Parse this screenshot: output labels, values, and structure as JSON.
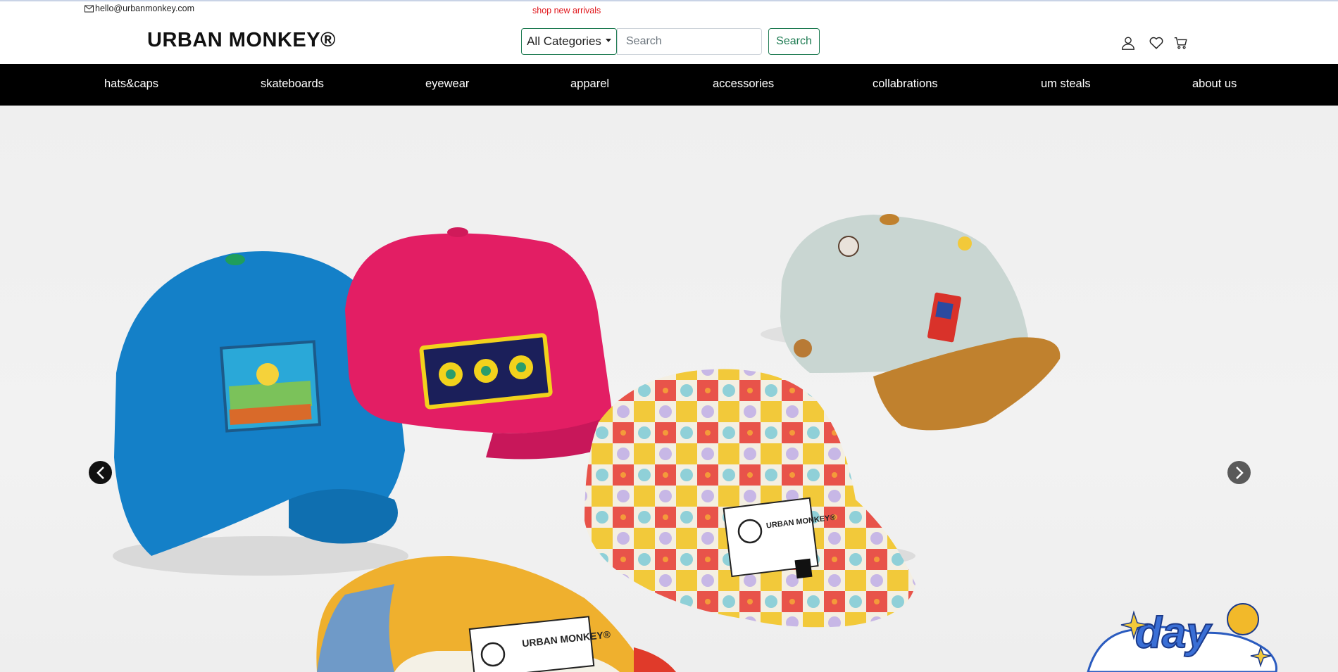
{
  "util": {
    "email": "hello@urbanmonkey.com",
    "promo": "shop new arrivals"
  },
  "header": {
    "logo": "URBAN MONKEY®",
    "category_label": "All Categories",
    "search_placeholder": "Search",
    "search_button": "Search",
    "icons": [
      "user-icon",
      "heart-icon",
      "cart-icon"
    ]
  },
  "nav": {
    "items": [
      "hats&caps",
      "skateboards",
      "eyewear",
      "apparel",
      "accessories",
      "collabrations",
      "um steals",
      "about us"
    ]
  },
  "hero": {
    "label_left_cap": "URBAN MONKEY®",
    "label_front_cap": "URBAN MONKEY®",
    "sticker_text": "day"
  },
  "colors": {
    "accent": "#1e7b52",
    "promo": "#e0161b",
    "navbar": "#000000"
  }
}
